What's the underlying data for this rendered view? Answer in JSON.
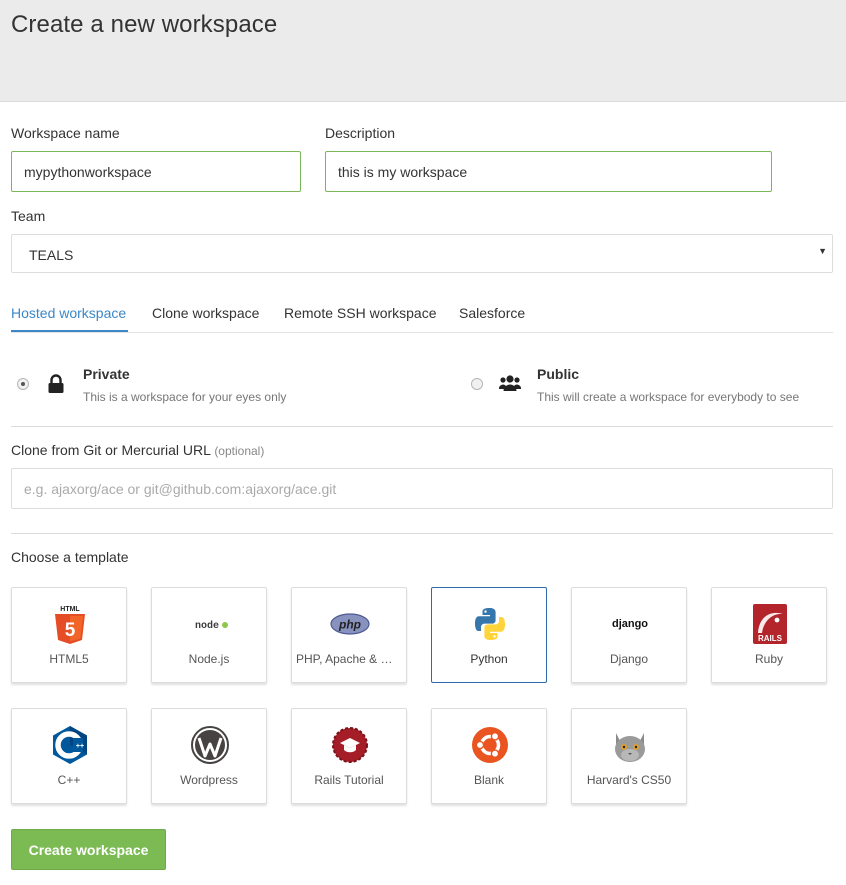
{
  "page": {
    "title": "Create a new workspace"
  },
  "form": {
    "name_label": "Workspace name",
    "name_value": "mypythonworkspace",
    "description_label": "Description",
    "description_value": "this is my workspace",
    "team_label": "Team",
    "team_value": "TEALS"
  },
  "tabs": [
    {
      "label": "Hosted workspace",
      "active": true
    },
    {
      "label": "Clone workspace",
      "active": false
    },
    {
      "label": "Remote SSH workspace",
      "active": false
    },
    {
      "label": "Salesforce",
      "active": false
    }
  ],
  "visibility": {
    "private": {
      "title": "Private",
      "description": "This is a workspace for your eyes only",
      "icon": "lock-icon",
      "selected": true
    },
    "public": {
      "title": "Public",
      "description": "This will create a workspace for everybody to see",
      "icon": "users-icon",
      "selected": false
    }
  },
  "clone": {
    "label": "Clone from Git or Mercurial URL",
    "optional": "(optional)",
    "placeholder": "e.g. ajaxorg/ace or git@github.com:ajaxorg/ace.git"
  },
  "templates": {
    "heading": "Choose a template",
    "selected": "Python",
    "items": [
      {
        "label": "HTML5",
        "icon": "html5-icon"
      },
      {
        "label": "Node.js",
        "icon": "nodejs-icon"
      },
      {
        "label": "PHP, Apache & MySQL",
        "icon": "php-icon"
      },
      {
        "label": "Python",
        "icon": "python-icon"
      },
      {
        "label": "Django",
        "icon": "django-icon"
      },
      {
        "label": "Ruby",
        "icon": "rails-icon"
      },
      {
        "label": "C++",
        "icon": "cpp-icon"
      },
      {
        "label": "Wordpress",
        "icon": "wordpress-icon"
      },
      {
        "label": "Rails Tutorial",
        "icon": "rails-tutorial-icon"
      },
      {
        "label": "Blank",
        "icon": "ubuntu-icon"
      },
      {
        "label": "Harvard's CS50",
        "icon": "cat-icon"
      }
    ],
    "icon_text": {
      "html5_top": "HTML",
      "html5_num": "5",
      "node": "node",
      "php": "php",
      "django": "django",
      "rails": "RAILS"
    }
  },
  "actions": {
    "create_label": "Create workspace"
  },
  "colors": {
    "accent": "#3b87c8",
    "button": "#7cba54",
    "input_border": "#7cb65a"
  }
}
